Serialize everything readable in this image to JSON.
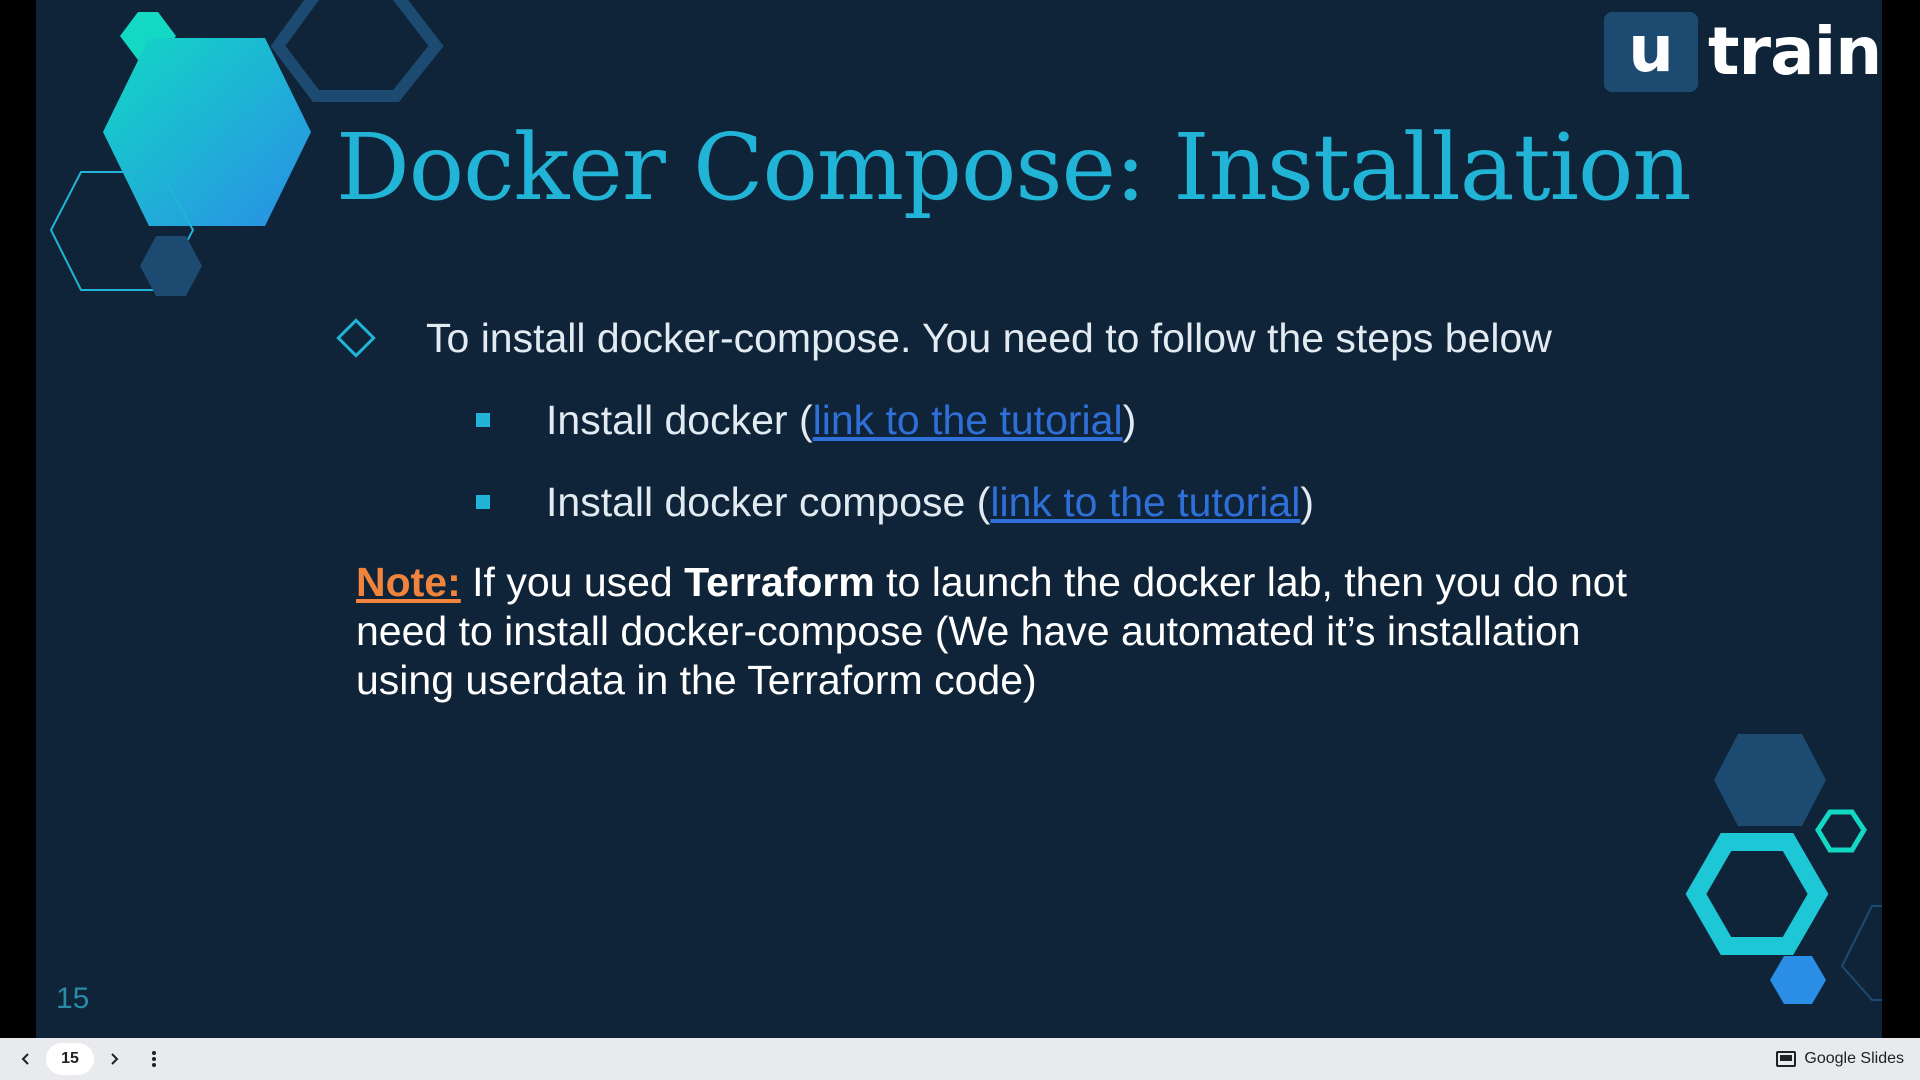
{
  "slide": {
    "title": "Docker Compose: Installation",
    "number": "15",
    "logo": {
      "letter": "u",
      "word": "train"
    },
    "bullet": "To install docker-compose. You need to follow the steps below",
    "sub_items": [
      {
        "prefix": "Install docker (",
        "link": "link to the tutorial",
        "suffix": ")"
      },
      {
        "prefix": "Install docker compose (",
        "link": "link to the tutorial",
        "suffix": ")"
      }
    ],
    "note": {
      "label": "Note:",
      "part1": " If you used ",
      "bold": "Terraform",
      "part2": " to launch the docker lab, then you do not need to install docker-compose (We have automated it’s installation using userdata in the Terraform code)"
    }
  },
  "toolbar": {
    "prev_icon": "chevron-left-icon",
    "page": "15",
    "next_icon": "chevron-right-icon",
    "more_icon": "more-vert-icon",
    "brand": "Google Slides"
  },
  "colors": {
    "background": "#0f2438",
    "accent": "#22b4d6",
    "link": "#2f6fd8",
    "note": "#f0843c",
    "toolbar": "#e8eaed"
  }
}
